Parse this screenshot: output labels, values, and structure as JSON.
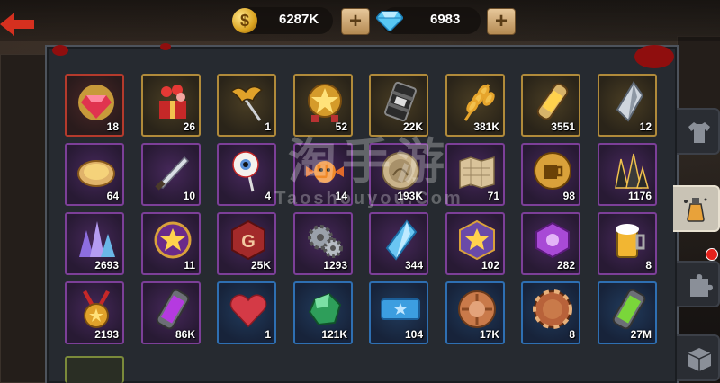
{
  "currency": {
    "coins": {
      "value": "6287K",
      "icon": "coin-icon",
      "icon_glyph": "$"
    },
    "gems": {
      "value": "6983",
      "icon": "diamond-icon"
    },
    "plus_glyph": "+"
  },
  "watermark": {
    "cn": "淘手游",
    "en": "Taoshouyou.Com"
  },
  "inventory": [
    {
      "qty": "18",
      "rarity": "red",
      "icon": "ruby-gem-icon"
    },
    {
      "qty": "26",
      "rarity": "gold",
      "icon": "gift-box-icon"
    },
    {
      "qty": "1",
      "rarity": "gold",
      "icon": "bat-scepter-icon"
    },
    {
      "qty": "52",
      "rarity": "gold",
      "icon": "star-medal-icon"
    },
    {
      "qty": "22K",
      "rarity": "gold",
      "icon": "oil-barrel-icon"
    },
    {
      "qty": "381K",
      "rarity": "gold",
      "icon": "wheat-icon"
    },
    {
      "qty": "3551",
      "rarity": "gold",
      "icon": "energy-capsule-icon"
    },
    {
      "qty": "12",
      "rarity": "gold",
      "icon": "crystal-shard-icon"
    },
    {
      "qty": "64",
      "rarity": "purple",
      "icon": "pie-icon"
    },
    {
      "qty": "10",
      "rarity": "purple",
      "icon": "knife-icon"
    },
    {
      "qty": "4",
      "rarity": "purple",
      "icon": "eyeball-lollipop-icon"
    },
    {
      "qty": "14",
      "rarity": "purple",
      "icon": "candy-icon"
    },
    {
      "qty": "193K",
      "rarity": "purple",
      "icon": "laurel-coin-icon"
    },
    {
      "qty": "71",
      "rarity": "purple",
      "icon": "map-icon"
    },
    {
      "qty": "98",
      "rarity": "purple",
      "icon": "mug-token-icon"
    },
    {
      "qty": "1176",
      "rarity": "purple",
      "icon": "dark-crystals-icon"
    },
    {
      "qty": "2693",
      "rarity": "purple",
      "icon": "crystal-cluster-icon"
    },
    {
      "qty": "11",
      "rarity": "purple",
      "icon": "star-badge-icon"
    },
    {
      "qty": "25K",
      "rarity": "purple",
      "icon": "g-hexagon-token-icon"
    },
    {
      "qty": "1293",
      "rarity": "purple",
      "icon": "gears-icon"
    },
    {
      "qty": "344",
      "rarity": "purple",
      "icon": "blue-shard-icon"
    },
    {
      "qty": "102",
      "rarity": "purple",
      "icon": "rank-badge-icon"
    },
    {
      "qty": "282",
      "rarity": "purple",
      "icon": "purple-hexagon-icon"
    },
    {
      "qty": "8",
      "rarity": "purple",
      "icon": "beer-mug-icon"
    },
    {
      "qty": "2193",
      "rarity": "purple",
      "icon": "gold-medal-icon"
    },
    {
      "qty": "86K",
      "rarity": "purple",
      "icon": "purple-canister-icon"
    },
    {
      "qty": "1",
      "rarity": "blue",
      "icon": "heart-icon"
    },
    {
      "qty": "121K",
      "rarity": "blue",
      "icon": "green-gem-icon"
    },
    {
      "qty": "104",
      "rarity": "blue",
      "icon": "ticket-icon"
    },
    {
      "qty": "17K",
      "rarity": "blue",
      "icon": "bronze-coin-icon"
    },
    {
      "qty": "8",
      "rarity": "blue",
      "icon": "copper-chip-icon"
    },
    {
      "qty": "27M",
      "rarity": "blue",
      "icon": "green-canister-icon"
    }
  ],
  "side_tabs": [
    {
      "icon": "shirt-icon",
      "active": false
    },
    {
      "icon": "potion-icon",
      "active": true
    },
    {
      "icon": "puzzle-piece-icon",
      "active": false,
      "notification": true
    },
    {
      "icon": "crate-icon",
      "active": false
    }
  ],
  "colors": {
    "red": "#b43a2c",
    "gold": "#b08a3a",
    "purple": "#7c3f98",
    "blue": "#2e6fb2",
    "accent_red": "#d5301f"
  }
}
